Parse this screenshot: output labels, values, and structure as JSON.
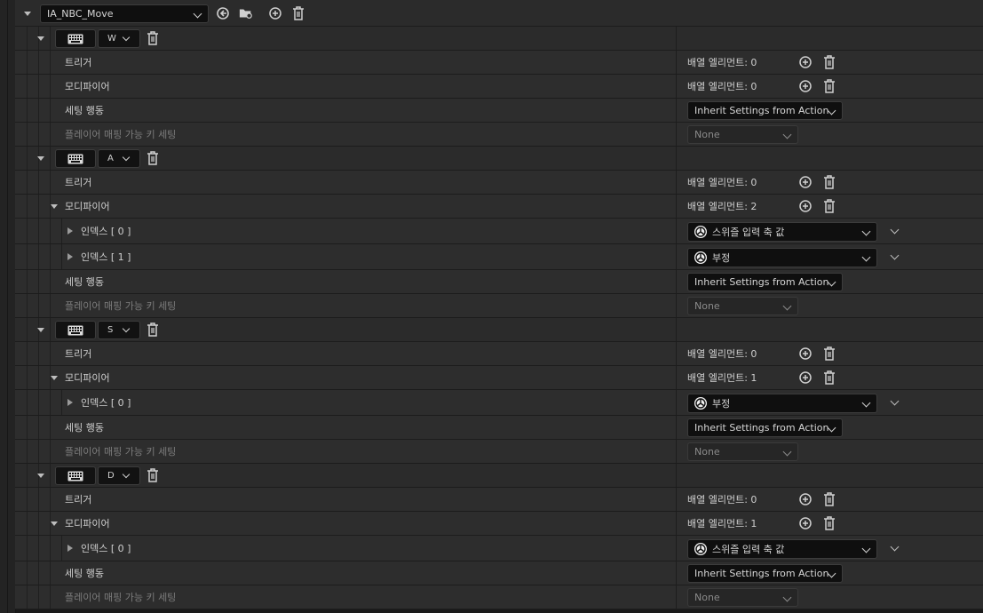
{
  "asset": {
    "name": "IA_NBC_Move"
  },
  "labels": {
    "trigger": "트리거",
    "modifier": "모디파이어",
    "setting_behavior": "세팅 행동",
    "player_mappable": "플레이어 매핑 가능 키 세팅",
    "array_elements_0": "배열 엘리먼트: 0",
    "array_elements_1": "배열 엘리먼트: 1",
    "array_elements_2": "배열 엘리먼트: 2",
    "index_0": "인덱스 [ 0 ]",
    "index_1": "인덱스 [ 1 ]",
    "inherit_settings": "Inherit Settings from Action",
    "none": "None",
    "swizzle": "스위즐 입력 축 값",
    "negate": "부정"
  },
  "mappings": [
    {
      "key": "W"
    },
    {
      "key": "A"
    },
    {
      "key": "S"
    },
    {
      "key": "D"
    }
  ],
  "icons": [
    "chevron-down-icon",
    "browse-back-icon",
    "folder-search-icon",
    "add-icon",
    "delete-icon",
    "keyboard-icon",
    "modifier-icon"
  ]
}
